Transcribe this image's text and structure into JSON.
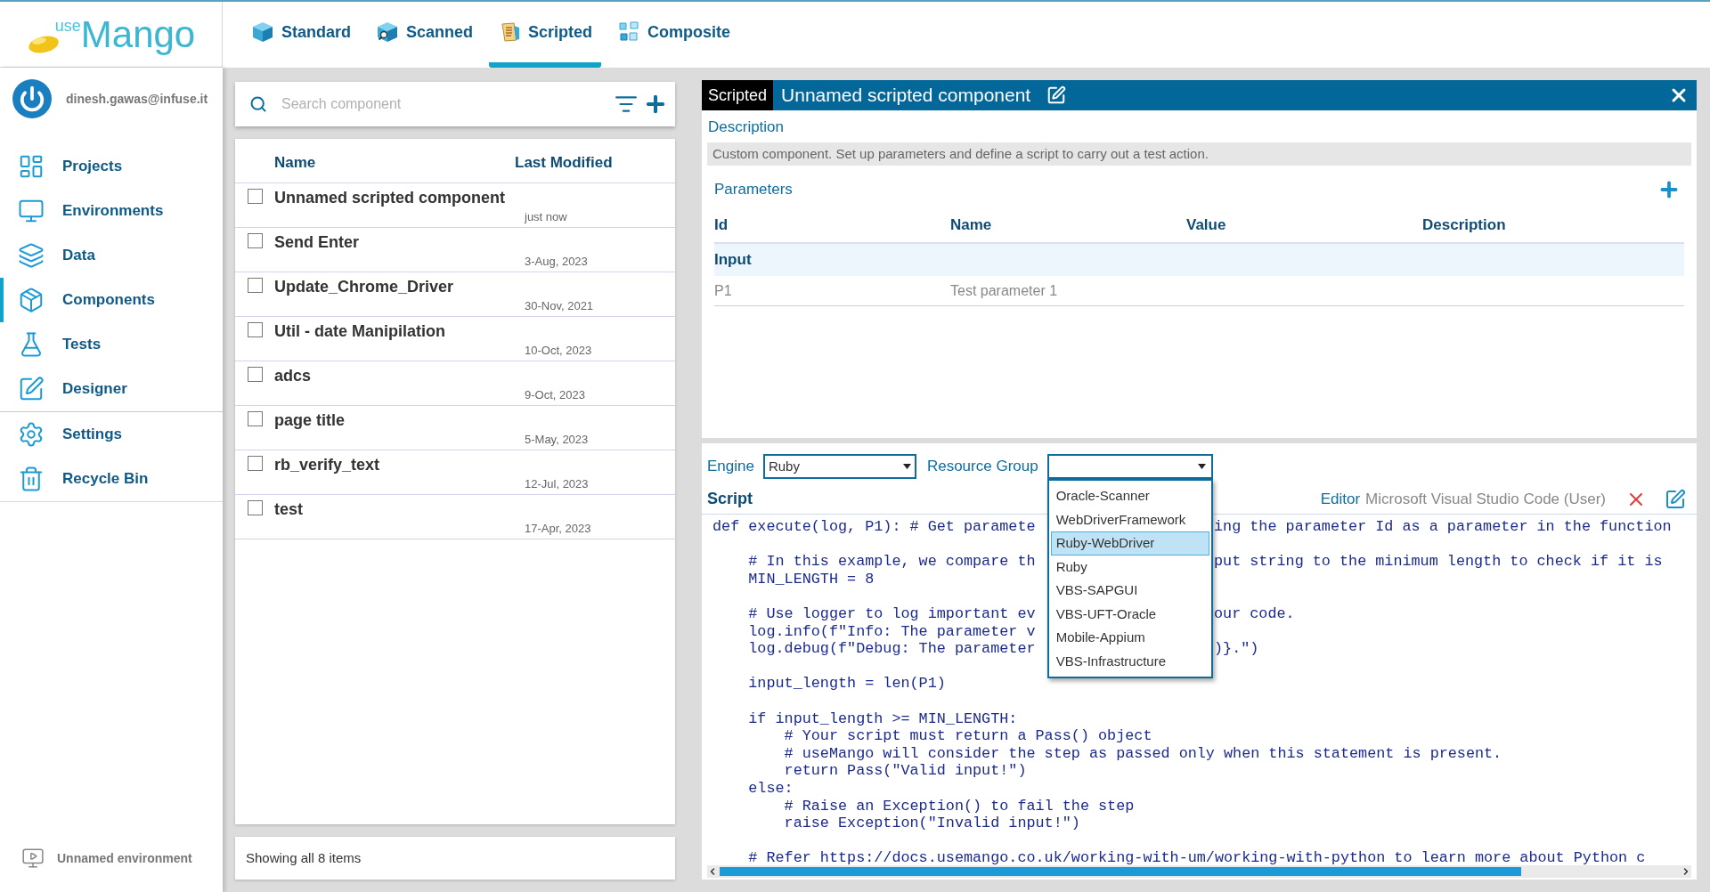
{
  "logo": {
    "small": "use",
    "large": "Mango"
  },
  "tabs": [
    {
      "label": "Standard",
      "kind": "standard",
      "selected": false
    },
    {
      "label": "Scanned",
      "kind": "scanned",
      "selected": false
    },
    {
      "label": "Scripted",
      "kind": "scripted",
      "selected": true
    },
    {
      "label": "Composite",
      "kind": "composite",
      "selected": false
    }
  ],
  "user": {
    "email": "dinesh.gawas@infuse.it"
  },
  "sidebar": {
    "items": [
      {
        "label": "Projects",
        "kind": "projects",
        "selected": false
      },
      {
        "label": "Environments",
        "kind": "environments",
        "selected": false
      },
      {
        "label": "Data",
        "kind": "data",
        "selected": false
      },
      {
        "label": "Components",
        "kind": "components",
        "selected": true
      },
      {
        "label": "Tests",
        "kind": "tests",
        "selected": false
      },
      {
        "label": "Designer",
        "kind": "designer",
        "selected": false
      },
      {
        "label": "Settings",
        "kind": "settings",
        "selected": false
      },
      {
        "label": "Recycle Bin",
        "kind": "recycle",
        "selected": false
      }
    ],
    "environment": "Unnamed environment"
  },
  "search": {
    "placeholder": "Search component"
  },
  "table": {
    "columns": [
      "Name",
      "Last Modified"
    ],
    "rows": [
      {
        "name": "Unnamed scripted component",
        "modified": "just now",
        "checked": false
      },
      {
        "name": "Send Enter",
        "modified": "3-Aug, 2023",
        "checked": false
      },
      {
        "name": "Update_Chrome_Driver",
        "modified": "30-Nov, 2021",
        "checked": false
      },
      {
        "name": "Util - date Manipilation",
        "modified": "10-Oct, 2023",
        "checked": false
      },
      {
        "name": "adcs",
        "modified": "9-Oct, 2023",
        "checked": false
      },
      {
        "name": "page title",
        "modified": "5-May, 2023",
        "checked": false
      },
      {
        "name": "rb_verify_text",
        "modified": "12-Jul, 2023",
        "checked": false
      },
      {
        "name": "test",
        "modified": "17-Apr, 2023",
        "checked": false
      }
    ],
    "footer": "Showing all 8 items"
  },
  "editor": {
    "badge": "Scripted",
    "title": "Unnamed scripted component",
    "description_label": "Description",
    "description": "Custom component. Set up parameters and define a script to carry out a test action.",
    "parameters_label": "Parameters",
    "parameter_columns": [
      "Id",
      "Name",
      "Value",
      "Description"
    ],
    "parameter_groups": [
      {
        "label": "Input",
        "rows": [
          {
            "id": "P1",
            "name": "Test parameter 1"
          }
        ]
      }
    ],
    "engine_label": "Engine",
    "engine": "Ruby",
    "resource_group_label": "Resource Group",
    "resource_group_options": [
      {
        "label": "Oracle-Scanner",
        "selected": false
      },
      {
        "label": "WebDriverFramework",
        "selected": false
      },
      {
        "label": "Ruby-WebDriver",
        "selected": true
      },
      {
        "label": "Ruby",
        "selected": false
      },
      {
        "label": "VBS-SAPGUI",
        "selected": false
      },
      {
        "label": "VBS-UFT-Oracle",
        "selected": false
      },
      {
        "label": "Mobile-Appium",
        "selected": false
      },
      {
        "label": "VBS-Infrastructure",
        "selected": false
      }
    ],
    "script_label": "Script",
    "editor_label": "Editor",
    "editor_name": "Microsoft Visual Studio Code (User)",
    "code_lines": [
      {
        "kind": "code",
        "text": "def execute(log, P1): # Get paramete",
        "text_right": "ing the parameter Id as a parameter in the function"
      },
      {
        "kind": "blank"
      },
      {
        "kind": "code",
        "text": "    # In this example, we compare th",
        "text_right": "put string to the minimum length to check if it is"
      },
      {
        "kind": "code",
        "text": "    MIN_LENGTH = 8"
      },
      {
        "kind": "blank"
      },
      {
        "kind": "code",
        "text": "    # Use logger to log important ev",
        "text_right": "our code."
      },
      {
        "kind": "code",
        "text": "    log.info(f\"Info: The parameter v"
      },
      {
        "kind": "code",
        "text": "    log.debug(f\"Debug: The parameter",
        "text_right": ")}.\")"
      },
      {
        "kind": "blank"
      },
      {
        "kind": "code",
        "text": "    input_length = len(P1)"
      },
      {
        "kind": "blank"
      },
      {
        "kind": "code",
        "text": "    if input_length >= MIN_LENGTH:"
      },
      {
        "kind": "code",
        "text": "        # Your script must return a Pass() object"
      },
      {
        "kind": "code",
        "text": "        # useMango will consider the step as passed only when this statement is present."
      },
      {
        "kind": "code",
        "text": "        return Pass(\"Valid input!\")"
      },
      {
        "kind": "code",
        "text": "    else:"
      },
      {
        "kind": "code",
        "text": "        # Raise an Exception() to fail the step"
      },
      {
        "kind": "code",
        "text": "        raise Exception(\"Invalid input!\")"
      },
      {
        "kind": "blank"
      },
      {
        "kind": "code",
        "text": "    # Refer https://docs.usemango.co.uk/working-with-um/working-with-python to learn more about Python c"
      }
    ]
  }
}
